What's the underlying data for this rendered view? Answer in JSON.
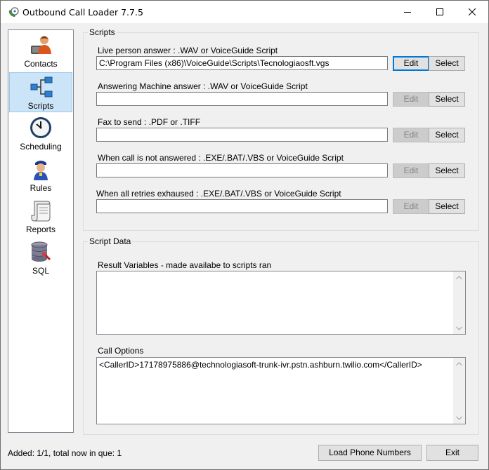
{
  "window": {
    "title": "Outbound Call Loader 7.7.5"
  },
  "sidebar": {
    "items": [
      {
        "label": "Contacts",
        "icon": "contacts-icon",
        "selected": false
      },
      {
        "label": "Scripts",
        "icon": "scripts-icon",
        "selected": true
      },
      {
        "label": "Scheduling",
        "icon": "clock-icon",
        "selected": false
      },
      {
        "label": "Rules",
        "icon": "rules-icon",
        "selected": false
      },
      {
        "label": "Reports",
        "icon": "scroll-icon",
        "selected": false
      },
      {
        "label": "SQL",
        "icon": "database-icon",
        "selected": false
      }
    ]
  },
  "scripts": {
    "group_title": "Scripts",
    "edit_label": "Edit",
    "select_label": "Select",
    "fields": [
      {
        "label": "Live person answer : .WAV or VoiceGuide Script",
        "value": "C:\\Program Files (x86)\\VoiceGuide\\Scripts\\Tecnologiaosft.vgs",
        "edit_enabled": true
      },
      {
        "label": "Answering Machine answer : .WAV or VoiceGuide Script",
        "value": "",
        "edit_enabled": false
      },
      {
        "label": "Fax to send : .PDF or .TIFF",
        "value": "",
        "edit_enabled": false
      },
      {
        "label": "When call is not answered : .EXE/.BAT/.VBS or VoiceGuide Script",
        "value": "",
        "edit_enabled": false
      },
      {
        "label": "When all retries exhaused : .EXE/.BAT/.VBS or VoiceGuide Script",
        "value": "",
        "edit_enabled": false
      }
    ]
  },
  "script_data": {
    "group_title": "Script Data",
    "result_variables_label": "Result Variables - made availabe to scripts ran",
    "result_variables_value": "",
    "call_options_label": "Call Options",
    "call_options_value": "<CallerID>17178975886@technologiasoft-trunk-ivr.pstn.ashburn.twilio.com</CallerID>"
  },
  "footer": {
    "status": "Added: 1/1, total now in que: 1",
    "load_button": "Load Phone Numbers",
    "exit_button": "Exit"
  },
  "colors": {
    "selection_bg": "#cce4f7",
    "default_button_border": "#0078d7"
  }
}
